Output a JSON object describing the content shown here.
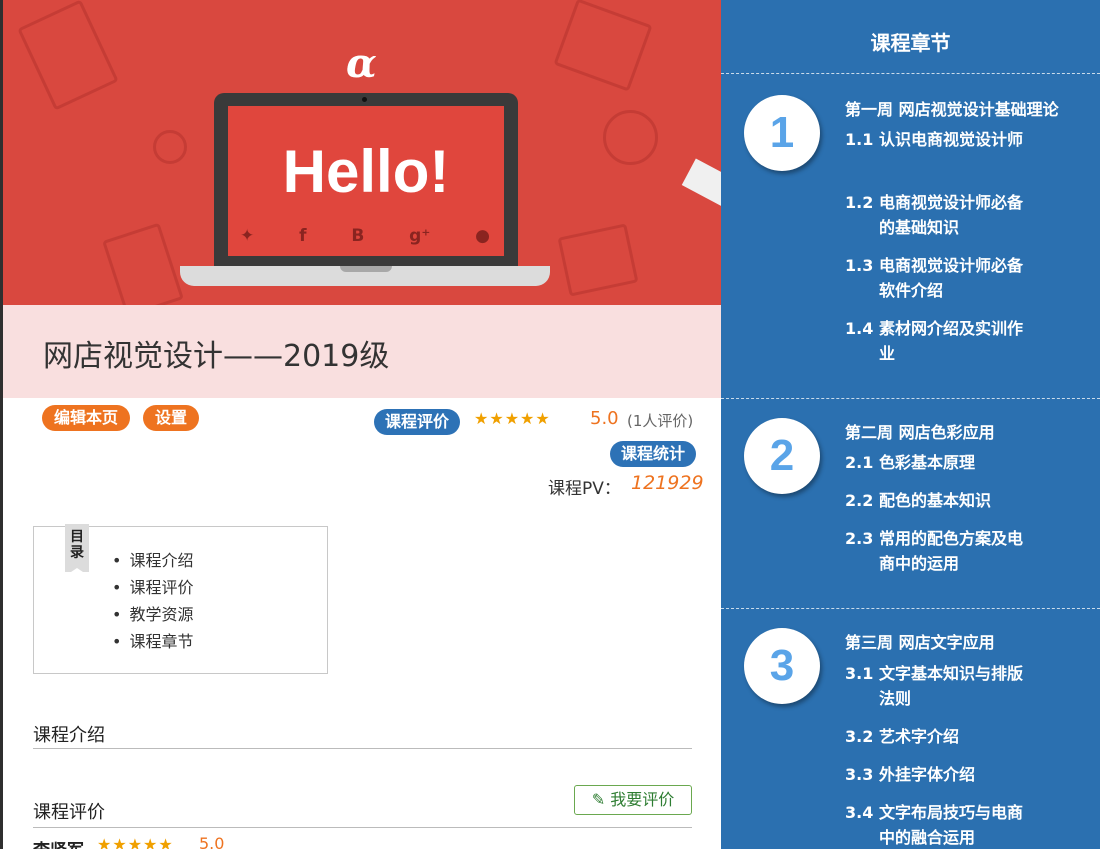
{
  "banner": {
    "logo_glyph": "α",
    "hello_text": "Hello!",
    "social_icons": [
      "twitter-icon",
      "facebook-icon",
      "blogger-icon",
      "google-plus-icon",
      "github-icon"
    ],
    "social_glyphs": [
      "✦",
      "f",
      "B",
      "g⁺",
      "●"
    ],
    "course_title": "网店视觉设计——2019级"
  },
  "actions": {
    "edit_label": "编辑本页",
    "settings_label": "设置"
  },
  "rating": {
    "badge_label": "课程评价",
    "stars": 5,
    "stars_glyphs": "★★★★★",
    "score": "5.0",
    "count_text": "(1人评价)"
  },
  "stats": {
    "badge_label": "课程统计",
    "pv_label": "课程PV：",
    "pv_value": "121929"
  },
  "toc": {
    "tag_label": "目录",
    "items": [
      "课程介绍",
      "课程评价",
      "教学资源",
      "课程章节"
    ]
  },
  "sections": {
    "intro_heading": "课程介绍",
    "review_heading": "课程评价",
    "write_review_label": "我要评价"
  },
  "review": {
    "name": "李贤军",
    "stars_glyphs": "★★★★★",
    "score": "5.0"
  },
  "chapters": {
    "title": "课程章节",
    "weeks": [
      {
        "number": "1",
        "title": "第一周 网店视觉设计基础理论",
        "lessons": [
          {
            "num": "1.1",
            "text": "认识电商视觉设计师"
          },
          {
            "num": "1.2",
            "text": "电商视觉设计师必备的基础知识"
          },
          {
            "num": "1.3",
            "text": "电商视觉设计师必备软件介绍"
          },
          {
            "num": "1.4",
            "text": "素材网介绍及实训作业"
          }
        ]
      },
      {
        "number": "2",
        "title": "第二周 网店色彩应用",
        "lessons": [
          {
            "num": "2.1",
            "text": "色彩基本原理"
          },
          {
            "num": "2.2",
            "text": "配色的基本知识"
          },
          {
            "num": "2.3",
            "text": "常用的配色方案及电商中的运用"
          }
        ]
      },
      {
        "number": "3",
        "title": "第三周 网店文字应用",
        "lessons": [
          {
            "num": "3.1",
            "text": "文字基本知识与排版法则"
          },
          {
            "num": "3.2",
            "text": "艺术字介绍"
          },
          {
            "num": "3.3",
            "text": "外挂字体介绍"
          },
          {
            "num": "3.4",
            "text": "文字布局技巧与电商中的融合运用"
          }
        ]
      }
    ]
  },
  "colors": {
    "banner_red": "#d9483f",
    "accent_orange": "#ee7320",
    "chapter_blue": "#2b70b0",
    "badge_blue": "#2d72b6",
    "star_gold": "#f0a000",
    "circle_number_blue": "#5aa4e8"
  }
}
